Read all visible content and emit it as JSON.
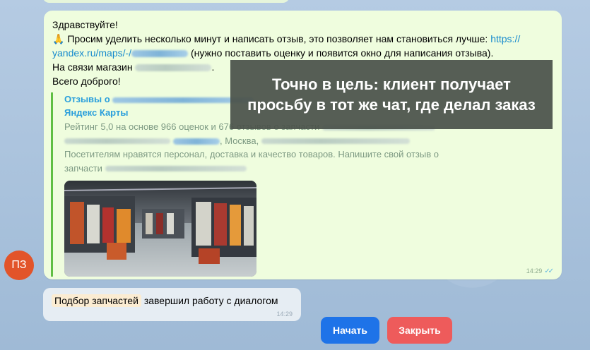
{
  "message": {
    "greeting": "Здравствуйте!",
    "emoji": "🙏",
    "request_text": "Просим уделить несколько минут и написать отзыв, это позволяет нам становиться лучше:",
    "link_start": "https://",
    "link_cont": "yandex.ru/maps/-/",
    "note": "(нужно поставить оценку и появится окно для написания отзыва).",
    "contact": "На связи магазин",
    "farewell": "Всего доброго!",
    "time": "14:29"
  },
  "preview": {
    "site_prefix": "Отзывы о",
    "site_name": "Яндекс Карты",
    "rating": "Рейтинг 5,0 на основе 966 оценок и 676 отзывов о запчасти",
    "city": ", Москва,",
    "desc_1": "Посетителям нравятся персонал, доставка и качество товаров. Напишите свой отзыв о",
    "desc_2": "запчасти"
  },
  "overlay": {
    "line1": "Точно в цель: клиент получает",
    "line2": "просьбу в тот же чат, где делал заказ"
  },
  "avatar": {
    "initials": "ПЗ",
    "color": "#e2542a"
  },
  "service": {
    "bot_name": "Подбор запчастей",
    "text": "завершил работу с диалогом",
    "time": "14:29"
  },
  "buttons": {
    "start": "Начать",
    "close": "Закрыть"
  },
  "colors": {
    "bubble": "#effdde",
    "link": "#168acd",
    "start_button": "#1e73e8",
    "close_button": "#ee5b5b"
  }
}
